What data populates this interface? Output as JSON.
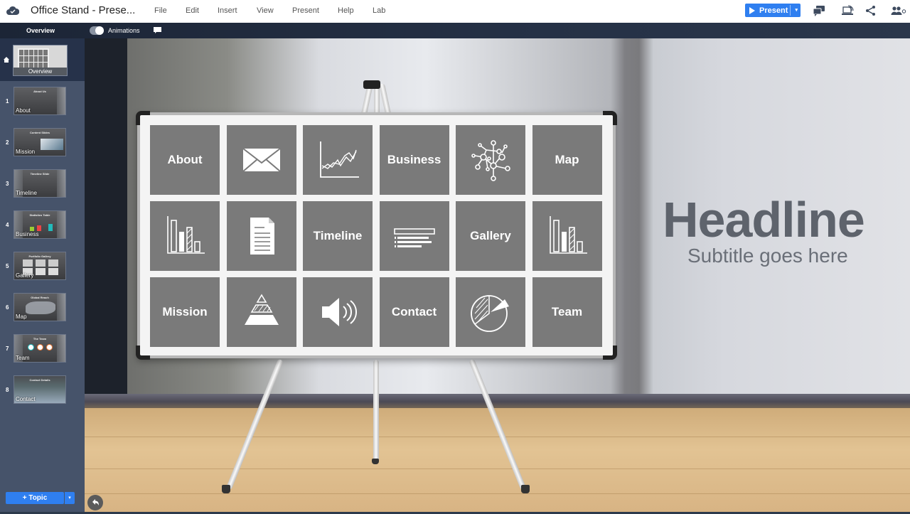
{
  "app": {
    "logo_icon": "cloud-check-icon",
    "document_title": "Office Stand - Prese...",
    "menu": [
      "File",
      "Edit",
      "Insert",
      "View",
      "Present",
      "Help",
      "Lab"
    ],
    "present_label": "Present",
    "present_caret": "▾",
    "right_icons": [
      "comments-icon",
      "cast-screen-icon",
      "share-icon",
      "collaborators-icon"
    ]
  },
  "subbar": {
    "overview_label": "Overview",
    "animations_label": "Animations",
    "animations_on": true,
    "comment_icon": "comment-icon"
  },
  "sidebar": {
    "overview": {
      "label": "Overview",
      "icon": "home-icon"
    },
    "slides": [
      {
        "num": "1",
        "label": "About",
        "title": "About Us"
      },
      {
        "num": "2",
        "label": "Mission",
        "title": "Content Slides"
      },
      {
        "num": "3",
        "label": "Timeline",
        "title": "Timeline Slide"
      },
      {
        "num": "4",
        "label": "Business",
        "title": "Statistics Table"
      },
      {
        "num": "5",
        "label": "Gallery",
        "title": "Portfolio Gallery"
      },
      {
        "num": "6",
        "label": "Map",
        "title": "Global Reach"
      },
      {
        "num": "7",
        "label": "Team",
        "title": "The Team"
      },
      {
        "num": "8",
        "label": "Contact",
        "title": "Contact Details"
      }
    ],
    "add_topic_label": "+ Topic",
    "add_topic_caret": "▾"
  },
  "canvas": {
    "headline": "Headline",
    "subtitle": "Subtitle goes here",
    "tiles": [
      {
        "type": "text",
        "label": "About"
      },
      {
        "type": "icon",
        "icon": "envelope-icon"
      },
      {
        "type": "icon",
        "icon": "line-chart-icon"
      },
      {
        "type": "text",
        "label": "Business"
      },
      {
        "type": "icon",
        "icon": "network-icon"
      },
      {
        "type": "text",
        "label": "Map"
      },
      {
        "type": "icon",
        "icon": "bar-chart-icon"
      },
      {
        "type": "icon",
        "icon": "document-icon"
      },
      {
        "type": "text",
        "label": "Timeline"
      },
      {
        "type": "icon",
        "icon": "text-lines-icon"
      },
      {
        "type": "text",
        "label": "Gallery"
      },
      {
        "type": "icon",
        "icon": "bar-chart-icon"
      },
      {
        "type": "text",
        "label": "Mission"
      },
      {
        "type": "icon",
        "icon": "pyramid-icon"
      },
      {
        "type": "icon",
        "icon": "speaker-icon"
      },
      {
        "type": "text",
        "label": "Contact"
      },
      {
        "type": "icon",
        "icon": "pie-chart-icon"
      },
      {
        "type": "text",
        "label": "Team"
      }
    ]
  },
  "colors": {
    "accent": "#2f7ff0",
    "tile": "#7a7a7a",
    "sidebar": "#46536a",
    "headline": "#5e636c"
  }
}
